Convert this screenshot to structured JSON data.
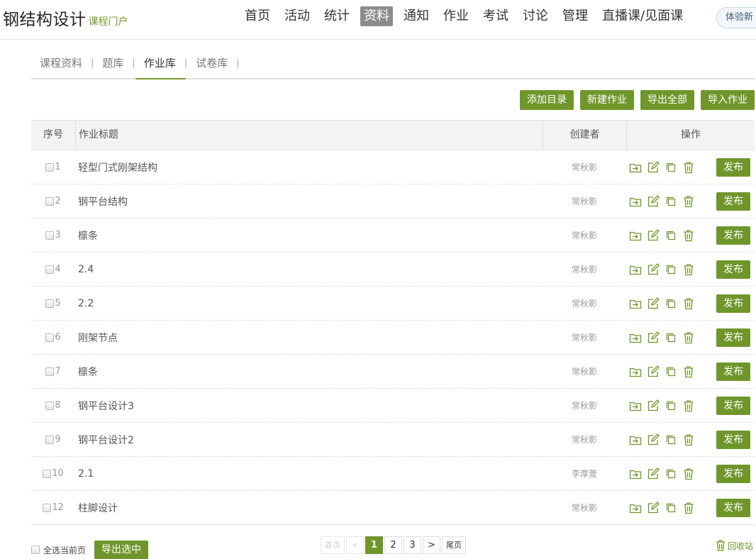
{
  "header": {
    "brand_title": "钢结构设计",
    "brand_sub": "课程门户",
    "nav": [
      {
        "label": "首页",
        "active": false
      },
      {
        "label": "活动",
        "active": false
      },
      {
        "label": "统计",
        "active": false
      },
      {
        "label": "资料",
        "active": true
      },
      {
        "label": "通知",
        "active": false
      },
      {
        "label": "作业",
        "active": false
      },
      {
        "label": "考试",
        "active": false
      },
      {
        "label": "讨论",
        "active": false
      },
      {
        "label": "管理",
        "active": false
      },
      {
        "label": "直播课/见面课",
        "active": false
      }
    ],
    "try_button": "体验新"
  },
  "subtabs": [
    {
      "label": "课程资料",
      "active": false
    },
    {
      "label": "题库",
      "active": false
    },
    {
      "label": "作业库",
      "active": true
    },
    {
      "label": "试卷库",
      "active": false
    }
  ],
  "actions": [
    "添加目录",
    "新建作业",
    "导出全部",
    "导入作业"
  ],
  "table": {
    "headers": {
      "no": "序号",
      "title": "作业标题",
      "creator": "创建者",
      "ops": "操作"
    },
    "publish_label": "发布",
    "rows": [
      {
        "no": "1",
        "title": "轻型门式刚架结构",
        "creator": "常秋影"
      },
      {
        "no": "2",
        "title": "钢平台结构",
        "creator": "常秋影"
      },
      {
        "no": "3",
        "title": "檩条",
        "creator": "常秋影"
      },
      {
        "no": "4",
        "title": "2.4",
        "creator": "常秋影"
      },
      {
        "no": "5",
        "title": "2.2",
        "creator": "常秋影"
      },
      {
        "no": "6",
        "title": "刚架节点",
        "creator": "常秋影"
      },
      {
        "no": "7",
        "title": "檩条",
        "creator": "常秋影"
      },
      {
        "no": "8",
        "title": "钢平台设计3",
        "creator": "常秋影"
      },
      {
        "no": "9",
        "title": "钢平台设计2",
        "creator": "常秋影"
      },
      {
        "no": "10",
        "title": "2.1",
        "creator": "李厚萱"
      },
      {
        "no": "12",
        "title": "柱脚设计",
        "creator": "常秋影"
      }
    ]
  },
  "footer": {
    "select_all_label": "全选当前页",
    "export_selected": "导出选中",
    "pager": {
      "first": "首页",
      "prev": "<",
      "pages": [
        "1",
        "2",
        "3"
      ],
      "current": "1",
      "next": ">",
      "last": "尾页"
    },
    "recycle_label": "回收站"
  },
  "colors": {
    "accent": "#6f962b",
    "nav_active": "#8c8c8c"
  }
}
